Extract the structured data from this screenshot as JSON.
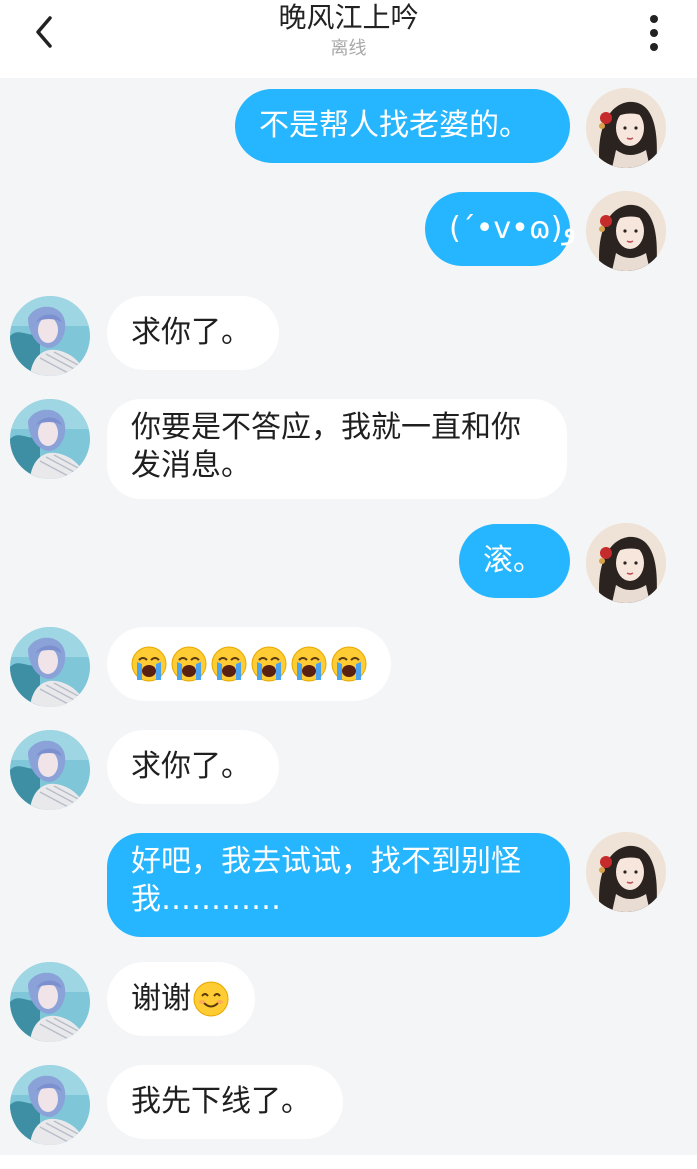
{
  "header": {
    "title": "晚风江上吟",
    "status": "离线"
  },
  "messages": [
    {
      "side": "me",
      "text": "不是帮人找老婆的。"
    },
    {
      "side": "me",
      "text": "(´•ᴠ•ɷ)و"
    },
    {
      "side": "them",
      "text": "求你了。"
    },
    {
      "side": "them",
      "line1": "你要是不答应，我就一直和你",
      "line2": "发消息。"
    },
    {
      "side": "me",
      "text": "滚。"
    },
    {
      "side": "them",
      "emoji": "loudly-crying-face",
      "count": 6
    },
    {
      "side": "them",
      "text": "求你了。"
    },
    {
      "side": "me",
      "line1": "好吧，我去试试，找不到别怪",
      "line2": "我…………"
    },
    {
      "side": "them",
      "text": "谢谢",
      "emoji": "smiling-face"
    },
    {
      "side": "them",
      "text": "我先下线了。"
    }
  ],
  "colors": {
    "my_bubble": "#26b6ff",
    "their_bubble": "#ffffff",
    "background": "#f4f5f7"
  }
}
